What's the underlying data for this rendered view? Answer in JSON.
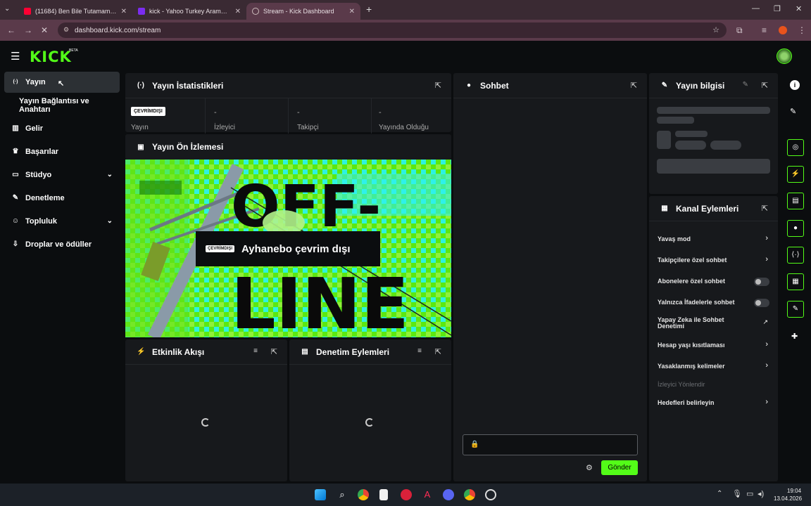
{
  "browser": {
    "tabs": [
      {
        "title": "(11684) Ben Bile Tutamam 💀 | K",
        "color": "#ff0033"
      },
      {
        "title": "kick - Yahoo Turkey Arama Son",
        "color": "#7b2cf0"
      },
      {
        "title": "Stream - Kick Dashboard",
        "color": "#53fc18"
      }
    ],
    "new_tab": "+",
    "url": "dashboard.kick.com/stream"
  },
  "app": {
    "logo": "KICK",
    "beta": "BETA"
  },
  "sidebar": {
    "items": [
      {
        "label": "Yayın",
        "icon": "broadcast-icon",
        "glyph": "((·))"
      },
      {
        "label": "Yayın Bağlantısı ve Anahtarı",
        "icon": "",
        "glyph": ""
      },
      {
        "label": "Gelir",
        "icon": "chart-icon",
        "glyph": "▥"
      },
      {
        "label": "Başarılar",
        "icon": "trophy-icon",
        "glyph": "🏆"
      },
      {
        "label": "Stüdyo",
        "icon": "studio-icon",
        "glyph": "▭"
      },
      {
        "label": "Denetleme",
        "icon": "wrench-icon",
        "glyph": "🔧"
      },
      {
        "label": "Topluluk",
        "icon": "people-icon",
        "glyph": "👥"
      },
      {
        "label": "Droplar ve ödüller",
        "icon": "gift-icon",
        "glyph": "⇩"
      }
    ]
  },
  "stats": {
    "title": "Yayın İstatistikleri",
    "badge": "ÇEVRİMDIŞI",
    "cells": [
      {
        "value": "",
        "label": "Yayın"
      },
      {
        "value": "-",
        "label": "İzleyici"
      },
      {
        "value": "-",
        "label": "Takipçi"
      },
      {
        "value": "-",
        "label": "Yayında Olduğu"
      }
    ]
  },
  "preview": {
    "title": "Yayın Ön İzlemesi",
    "offline_top": "OFF-",
    "offline_bottom": "LINE",
    "badge": "ÇEVRİMDIŞI",
    "caption": "Ayhanebo çevrim dışı"
  },
  "activity": {
    "title": "Etkinlik Akışı"
  },
  "mod_actions": {
    "title": "Denetim Eylemleri"
  },
  "chat": {
    "title": "Sohbet",
    "send": "Gönder"
  },
  "stream_info": {
    "title": "Yayın bilgisi"
  },
  "channel_actions": {
    "title": "Kanal Eylemleri",
    "items": [
      {
        "label": "Yavaş mod",
        "kind": "chevron"
      },
      {
        "label": "Takipçilere özel sohbet",
        "kind": "chevron"
      },
      {
        "label": "Abonelere özel sohbet",
        "kind": "toggle"
      },
      {
        "label": "Yalnızca İfadelerle sohbet",
        "kind": "toggle"
      },
      {
        "label": "Yapay Zeka ile Sohbet Denetimi",
        "kind": "external"
      },
      {
        "label": "Hesap yaşı kısıtlaması",
        "kind": "chevron"
      },
      {
        "label": "Yasaklanmış kelimeler",
        "kind": "chevron"
      },
      {
        "label": "İzleyici Yönlendir",
        "kind": "disabled"
      },
      {
        "label": "Hedefleri belirleyin",
        "kind": "chevron"
      }
    ]
  },
  "taskbar": {
    "time": "19:04",
    "date": "13.04.2026"
  }
}
